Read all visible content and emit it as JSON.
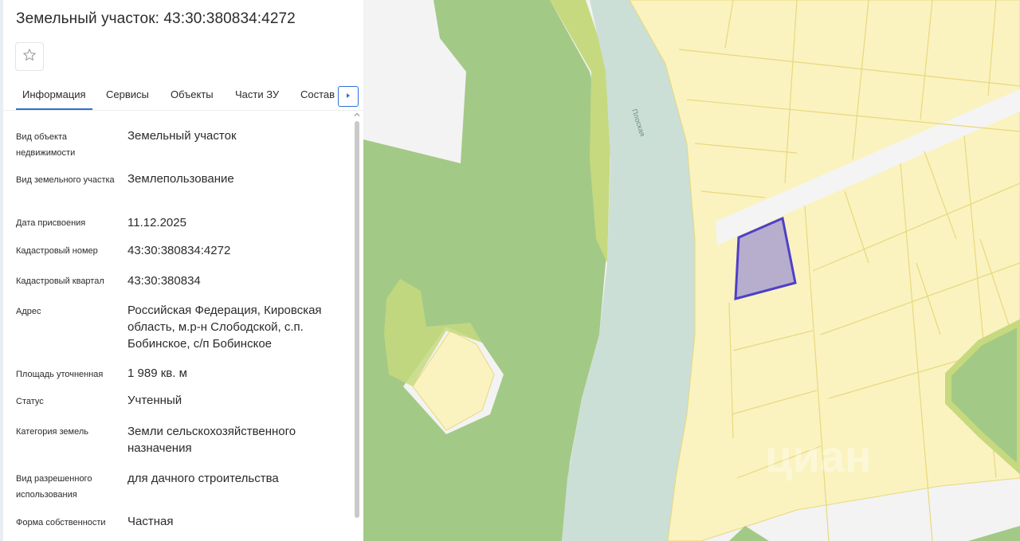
{
  "panel": {
    "title": "Земельный участок: 43:30:380834:4272"
  },
  "tabs": [
    {
      "label": "Информация"
    },
    {
      "label": "Сервисы"
    },
    {
      "label": "Объекты"
    },
    {
      "label": "Части ЗУ"
    },
    {
      "label": "Состав"
    }
  ],
  "icons": {
    "favorite": "star-icon",
    "next_tabs": "chevron-right-icon",
    "scroll_up": "chevron-up-icon"
  },
  "info": [
    {
      "label": "Вид объекта недвижимости",
      "value": "Земельный участок"
    },
    {
      "label": "Вид земельного участка",
      "value": "Землепользование"
    },
    {
      "label": "Дата присвоения",
      "value": "11.12.2025"
    },
    {
      "label": "Кадастровый номер",
      "value": "43:30:380834:4272"
    },
    {
      "label": "Кадастровый квартал",
      "value": "43:30:380834"
    },
    {
      "label": "Адрес",
      "value": "Российская Федерация, Кировская область, м.р-н Слободской, с.п. Бобинское, с/п Бобинское"
    },
    {
      "label": "Площадь уточненная",
      "value": "1 989 кв. м"
    },
    {
      "label": "Статус",
      "value": "Учтенный"
    },
    {
      "label": "Категория земель",
      "value": "Земли сельскохозяйственного назначения"
    },
    {
      "label": "Вид разрешенного использования",
      "value": "для дачного строительства"
    },
    {
      "label": "Форма собственности",
      "value": "Частная"
    }
  ],
  "map": {
    "river_label": "Плоская",
    "watermark": "циан",
    "colors": {
      "forest": "#a3c986",
      "parcels": "#faf3c0",
      "parcel_border": "#e8d87c",
      "river": "#cbdfd6",
      "selected_fill": "#b6aecc",
      "selected_border": "#4f3fc9",
      "road": "#f4f4f4",
      "accent": "#2f6fd6"
    }
  }
}
